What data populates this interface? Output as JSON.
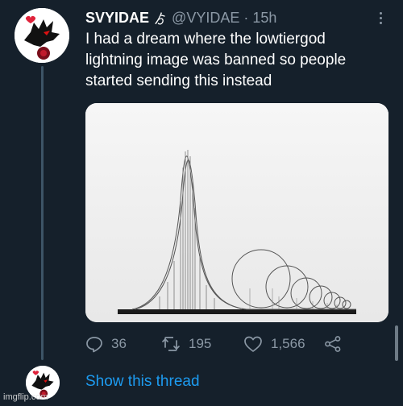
{
  "tweet": {
    "display_name": "SVYIDAE",
    "name_badge": "ゟ",
    "handle": "@VYIDAE",
    "separator": "·",
    "time": "15h",
    "text": "I had a dream where the lowtiergod lightning image was banned so people started sending this instead",
    "media_icon": "roller-coaster-sculpture-image",
    "avatar_icon": "black-wolf-avatar-icon",
    "more_icon": "more-options-icon"
  },
  "actions": {
    "reply_count": "36",
    "retweet_count": "195",
    "like_count": "1,566"
  },
  "show_thread_label": "Show this thread",
  "watermark": "imgflip.com",
  "colors": {
    "background": "#15202b",
    "secondary_text": "#8b98a5",
    "link": "#1d9bf0",
    "thread_line": "#3d5466"
  }
}
